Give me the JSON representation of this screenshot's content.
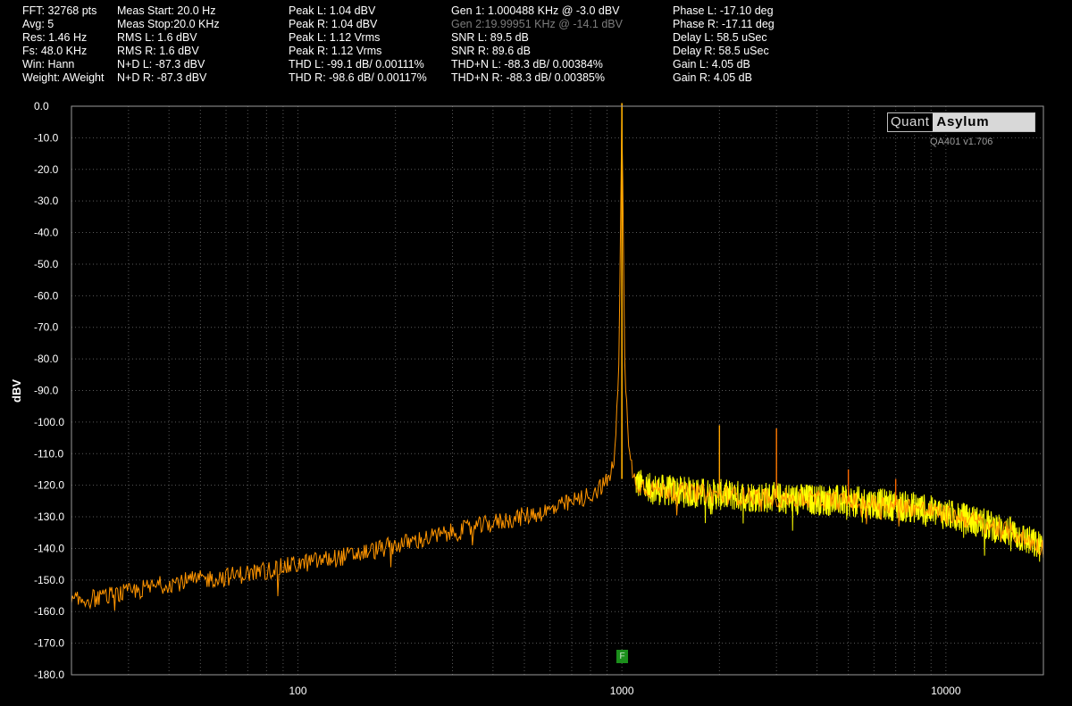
{
  "window": {
    "app": "QuantAsylum QA401"
  },
  "stats": [
    {
      "id": "fft",
      "text": "FFT: 32768 pts"
    },
    {
      "id": "avg",
      "text": "Avg: 5"
    },
    {
      "id": "res",
      "text": "Res: 1.46 Hz"
    },
    {
      "id": "fs",
      "text": "Fs: 48.0 KHz"
    },
    {
      "id": "win",
      "text": "Win: Hann"
    },
    {
      "id": "weight",
      "text": "Weight: AWeight"
    },
    {
      "id": "meas-start",
      "text": "Meas Start: 20.0 Hz"
    },
    {
      "id": "meas-stop",
      "text": "Meas Stop:20.0 KHz"
    },
    {
      "id": "rms-l",
      "text": "RMS L: 1.6 dBV"
    },
    {
      "id": "rms-r",
      "text": "RMS R: 1.6 dBV"
    },
    {
      "id": "nd-l",
      "text": "N+D L: -87.3 dBV"
    },
    {
      "id": "nd-r",
      "text": "N+D R: -87.3 dBV"
    },
    {
      "id": "peak-l",
      "text": "Peak L: 1.04 dBV"
    },
    {
      "id": "peak-r",
      "text": "Peak R: 1.04 dBV"
    },
    {
      "id": "peak-l-v",
      "text": "Peak L: 1.12 Vrms"
    },
    {
      "id": "peak-r-v",
      "text": "Peak R: 1.12 Vrms"
    },
    {
      "id": "thd-l",
      "text": "THD L: -99.1 dB/ 0.00111%"
    },
    {
      "id": "thd-r",
      "text": "THD R: -98.6 dB/ 0.00117%"
    },
    {
      "id": "gen1",
      "text": "Gen 1: 1.000488 KHz @ -3.0  dBV"
    },
    {
      "id": "gen2",
      "text": "Gen 2:19.99951 KHz @ -14.1  dBV",
      "dim": true
    },
    {
      "id": "snr-l",
      "text": "SNR L: 89.5 dB"
    },
    {
      "id": "snr-r",
      "text": "SNR R: 89.6 dB"
    },
    {
      "id": "thdn-l",
      "text": "THD+N L: -88.3 dB/ 0.00384%"
    },
    {
      "id": "thdn-r",
      "text": "THD+N R: -88.3 dB/ 0.00385%"
    },
    {
      "id": "phase-l",
      "text": "Phase L: -17.10 deg"
    },
    {
      "id": "phase-r",
      "text": "Phase R: -17.11 deg"
    },
    {
      "id": "delay-l",
      "text": "Delay L: 58.5 uSec"
    },
    {
      "id": "delay-r",
      "text": "Delay R: 58.5 uSec"
    },
    {
      "id": "gain-l",
      "text": "Gain L: 4.05 dB"
    },
    {
      "id": "gain-r",
      "text": "Gain R: 4.05 dB"
    }
  ],
  "logo": {
    "left": "Quant",
    "right": "Asylum"
  },
  "version": "QA401 v1.706",
  "marker": {
    "label": "F",
    "color": "#1b8f1b"
  },
  "colors": {
    "background": "#000000",
    "grid": "#5a5a5a",
    "trace_left": "#ffff00",
    "trace_right": "#ff9500"
  },
  "chart_data": {
    "type": "line",
    "title": "",
    "xlabel": "",
    "ylabel": "dBV",
    "xscale": "log",
    "xlim": [
      20,
      20000
    ],
    "ylim": [
      -180,
      0
    ],
    "grid": true,
    "yticks": [
      0,
      -10,
      -20,
      -30,
      -40,
      -50,
      -60,
      -70,
      -80,
      -90,
      -100,
      -110,
      -120,
      -130,
      -140,
      -150,
      -160,
      -170,
      -180
    ],
    "ytick_labels": [
      "0.0",
      "-10.0",
      "-20.0",
      "-30.0",
      "-40.0",
      "-50.0",
      "-60.0",
      "-70.0",
      "-80.0",
      "-90.0",
      "-100.0",
      "-110.0",
      "-120.0",
      "-130.0",
      "-140.0",
      "-150.0",
      "-160.0",
      "-170.0",
      "-180.0"
    ],
    "xticks": [
      100,
      1000,
      10000
    ],
    "xtick_labels": [
      "100",
      "1000",
      "10000"
    ],
    "series": [
      {
        "color": "#ff9500",
        "x": [
          20,
          30,
          40,
          60,
          80,
          100,
          150,
          200,
          300,
          400,
          600,
          800,
          900,
          950,
          980,
          1000,
          1020,
          1050,
          1100,
          1200,
          1500,
          2000,
          3000,
          5000,
          8000,
          12000,
          16000,
          20000
        ],
        "y": [
          -157,
          -154,
          -151,
          -149,
          -147,
          -145,
          -142,
          -139,
          -135,
          -132,
          -128,
          -123,
          -119,
          -112,
          -80,
          1,
          -80,
          -110,
          -119,
          -121,
          -122,
          -123,
          -124,
          -125,
          -127,
          -131,
          -135,
          -140
        ],
        "noise_db": 3
      },
      {
        "color": "#ffff00",
        "x": [
          1100,
          1200,
          1500,
          2000,
          3000,
          5000,
          8000,
          12000,
          16000,
          20000
        ],
        "y": [
          -119,
          -121,
          -122,
          -123,
          -124,
          -125,
          -127,
          -131,
          -135,
          -140
        ],
        "noise_db": 5
      }
    ],
    "spurs": [
      {
        "x": 2000,
        "y": -101,
        "color": "#ffa500"
      },
      {
        "x": 3000,
        "y": -102,
        "color": "#ff7a00"
      },
      {
        "x": 5000,
        "y": -115,
        "color": "#ff6a00"
      },
      {
        "x": 7000,
        "y": -118,
        "color": "#ff6a00"
      }
    ]
  }
}
